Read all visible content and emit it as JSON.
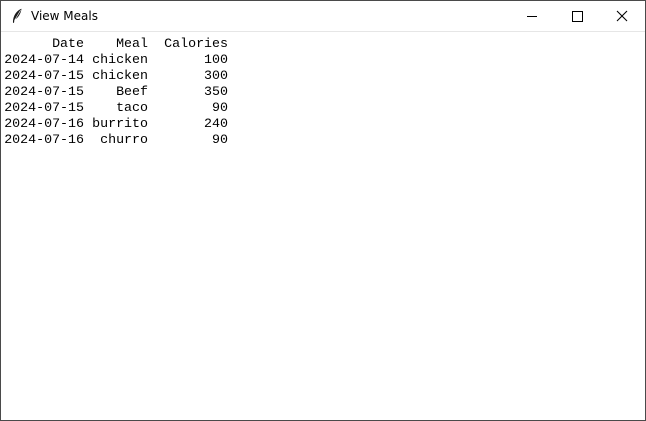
{
  "window": {
    "title": "View Meals",
    "icon": "feather-icon"
  },
  "controls": {
    "minimize_icon": "minimize-icon",
    "maximize_icon": "maximize-icon",
    "close_icon": "close-icon"
  },
  "table": {
    "headers": [
      "Date",
      "Meal",
      "Calories"
    ],
    "rows": [
      [
        "2024-07-14",
        "chicken",
        "100"
      ],
      [
        "2024-07-15",
        "chicken",
        "300"
      ],
      [
        "2024-07-15",
        "Beef",
        "350"
      ],
      [
        "2024-07-15",
        "taco",
        "90"
      ],
      [
        "2024-07-16",
        "burrito",
        "240"
      ],
      [
        "2024-07-16",
        "churro",
        "90"
      ]
    ]
  }
}
